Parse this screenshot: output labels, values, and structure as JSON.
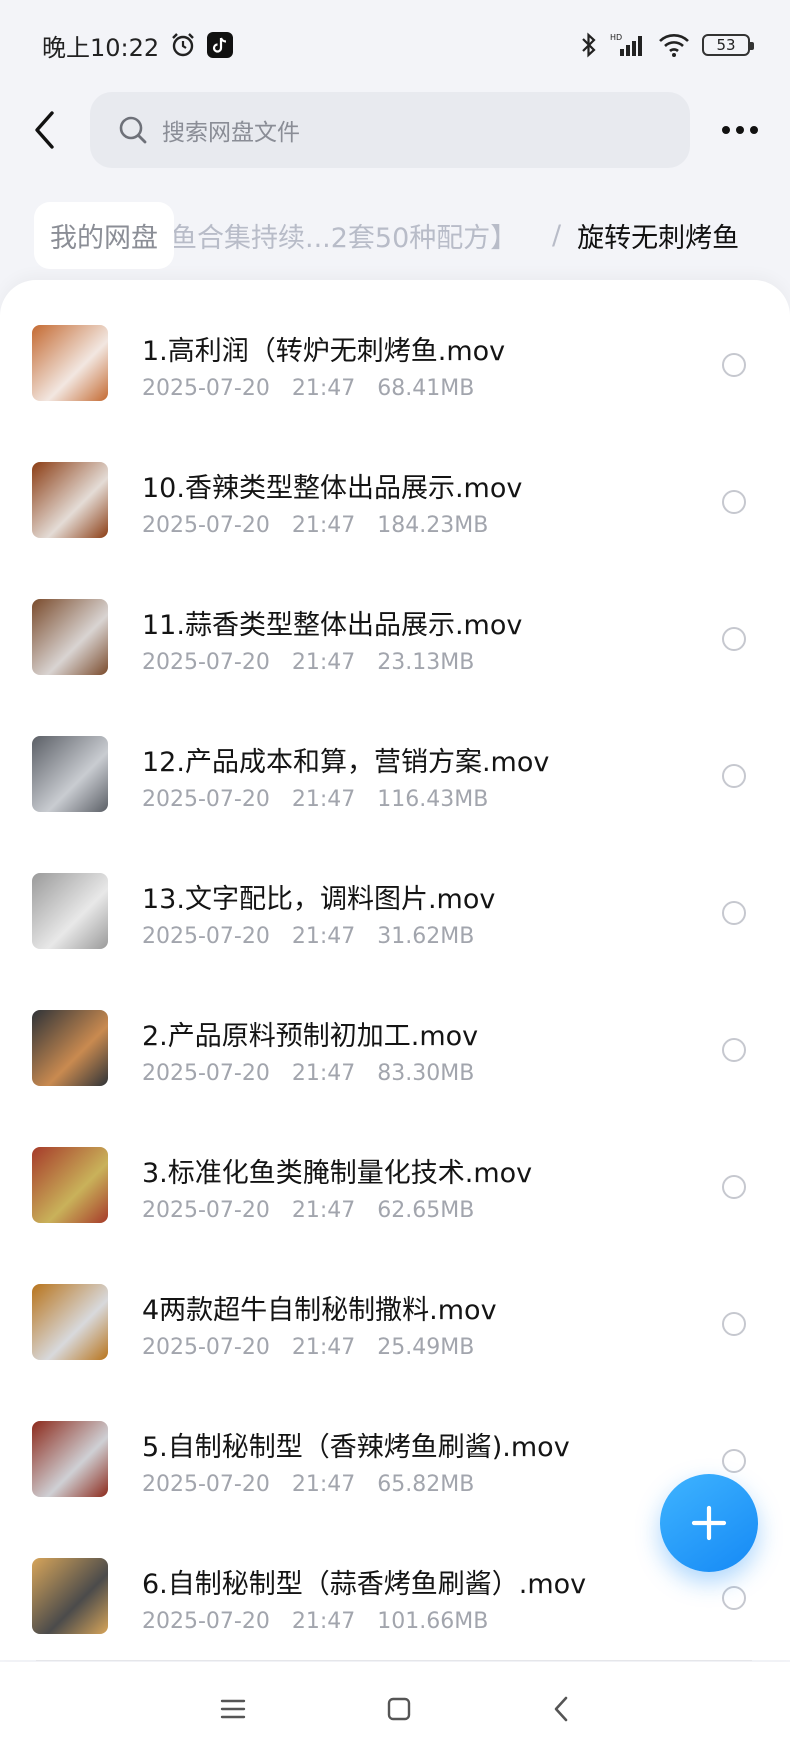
{
  "status_bar": {
    "time": "晚上10:22",
    "network": "HD",
    "battery": "53"
  },
  "search": {
    "placeholder": "搜索网盘文件"
  },
  "breadcrumb": {
    "root": "我的网盘",
    "middle": "鱼合集持续...2套50种配方】",
    "separator": "/",
    "current": "旋转无刺烤鱼"
  },
  "files": [
    {
      "name": "1.高利润（转炉无刺烤鱼.mov",
      "date": "2025-07-20",
      "time": "21:47",
      "size": "68.41MB",
      "thumb": [
        "#c46a32",
        "#f2e7e1"
      ]
    },
    {
      "name": "10.香辣类型整体出品展示.mov",
      "date": "2025-07-20",
      "time": "21:47",
      "size": "184.23MB",
      "thumb": [
        "#8b3d14",
        "#e4dcd6"
      ]
    },
    {
      "name": "11.蒜香类型整体出品展示.mov",
      "date": "2025-07-20",
      "time": "21:47",
      "size": "23.13MB",
      "thumb": [
        "#7a4b2c",
        "#d9d4d2"
      ]
    },
    {
      "name": "12.产品成本和算，营销方案.mov",
      "date": "2025-07-20",
      "time": "21:47",
      "size": "116.43MB",
      "thumb": [
        "#5b5f66",
        "#c9ccd1"
      ]
    },
    {
      "name": "13.文字配比，调料图片.mov",
      "date": "2025-07-20",
      "time": "21:47",
      "size": "31.62MB",
      "thumb": [
        "#9a9a9a",
        "#e8e8e8"
      ]
    },
    {
      "name": "2.产品原料预制初加工.mov",
      "date": "2025-07-20",
      "time": "21:47",
      "size": "83.30MB",
      "thumb": [
        "#2f3338",
        "#c98a50"
      ]
    },
    {
      "name": "3.标准化鱼类腌制量化技术.mov",
      "date": "2025-07-20",
      "time": "21:47",
      "size": "62.65MB",
      "thumb": [
        "#a63b2a",
        "#c9b25a"
      ]
    },
    {
      "name": "4两款超牛自制秘制撒料.mov",
      "date": "2025-07-20",
      "time": "21:47",
      "size": "25.49MB",
      "thumb": [
        "#b8741c",
        "#d8d9dc"
      ]
    },
    {
      "name": "5.自制秘制型（香辣烤鱼刷酱).mov",
      "date": "2025-07-20",
      "time": "21:47",
      "size": "65.82MB",
      "thumb": [
        "#8c2a1c",
        "#cfd0d4"
      ]
    },
    {
      "name": "6.自制秘制型（蒜香烤鱼刷酱）.mov",
      "date": "2025-07-20",
      "time": "21:47",
      "size": "101.66MB",
      "thumb": [
        "#d7a55a",
        "#4b4b4b"
      ]
    }
  ],
  "colors": {
    "accent": "#1589f5",
    "meta_text": "#a2a5ad",
    "background": "#f3f4f8"
  }
}
